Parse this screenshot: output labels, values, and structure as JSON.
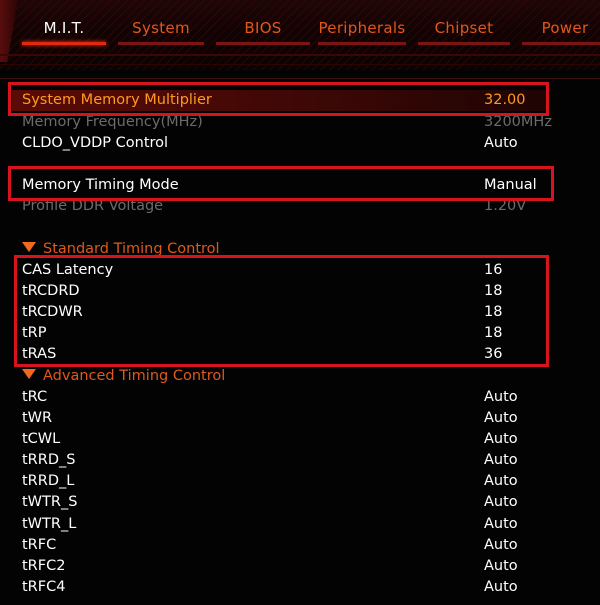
{
  "tabs": [
    {
      "label": "M.I.T.",
      "active": true
    },
    {
      "label": "System",
      "active": false
    },
    {
      "label": "BIOS",
      "active": false
    },
    {
      "label": "Peripherals",
      "active": false
    },
    {
      "label": "Chipset",
      "active": false
    },
    {
      "label": "Power",
      "active": false
    }
  ],
  "settings": {
    "memory_multiplier": {
      "label": "System Memory Multiplier",
      "value": "32.00"
    },
    "memory_frequency": {
      "label": "Memory Frequency(MHz)",
      "value": "3200MHz"
    },
    "cldo_vddp": {
      "label": "CLDO_VDDP Control",
      "value": "Auto"
    },
    "timing_mode": {
      "label": "Memory Timing Mode",
      "value": "Manual"
    },
    "profile_ddr_voltage": {
      "label": "Profile DDR Voltage",
      "value": "1.20V"
    }
  },
  "standard_timing": {
    "title": "Standard Timing Control",
    "items": [
      {
        "label": "CAS Latency",
        "value": "16"
      },
      {
        "label": "tRCDRD",
        "value": "18"
      },
      {
        "label": "tRCDWR",
        "value": "18"
      },
      {
        "label": "tRP",
        "value": "18"
      },
      {
        "label": "tRAS",
        "value": "36"
      }
    ]
  },
  "advanced_timing": {
    "title": "Advanced Timing Control",
    "items": [
      {
        "label": "tRC",
        "value": "Auto"
      },
      {
        "label": "tWR",
        "value": "Auto"
      },
      {
        "label": "tCWL",
        "value": "Auto"
      },
      {
        "label": "tRRD_S",
        "value": "Auto"
      },
      {
        "label": "tRRD_L",
        "value": "Auto"
      },
      {
        "label": "tWTR_S",
        "value": "Auto"
      },
      {
        "label": "tWTR_L",
        "value": "Auto"
      },
      {
        "label": "tRFC",
        "value": "Auto"
      },
      {
        "label": "tRFC2",
        "value": "Auto"
      },
      {
        "label": "tRFC4",
        "value": "Auto"
      }
    ]
  },
  "colors": {
    "accent": "#e0581c",
    "highlight_text": "#ff9a1e",
    "annotation_box": "#d8131e",
    "dim_text": "#6b6b6b"
  }
}
